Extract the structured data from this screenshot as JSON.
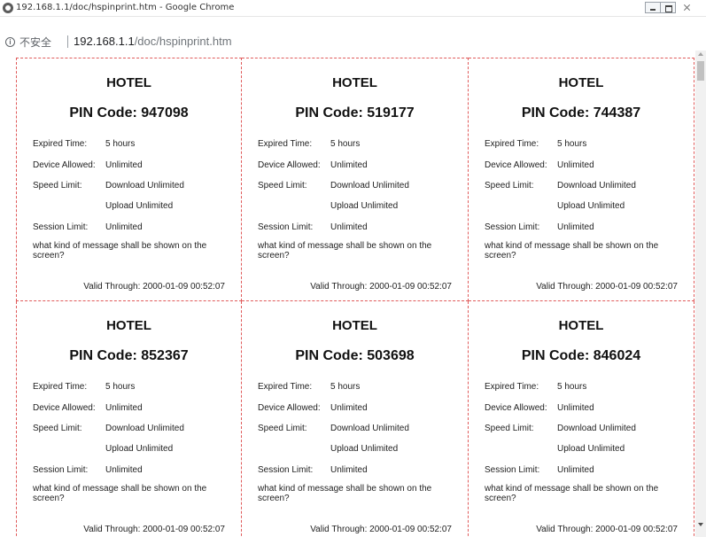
{
  "window": {
    "title": "192.168.1.1/doc/hspinprint.htm - Google Chrome"
  },
  "addressbar": {
    "security_label": "不安全",
    "url_host": "192.168.1.1",
    "url_path": "/doc/hspinprint.htm"
  },
  "labels": {
    "expired_time": "Expired Time:",
    "device_allowed": "Device Allowed:",
    "speed_limit": "Speed Limit:",
    "session_limit": "Session Limit:"
  },
  "cards": [
    {
      "hotel": "HOTEL",
      "pin": "PIN Code: 947098",
      "expired": "5 hours",
      "device": "Unlimited",
      "download": "Download Unlimited",
      "upload": "Upload Unlimited",
      "session": "Unlimited",
      "message": "what kind of message shall be shown on the screen?",
      "valid": "Valid Through: 2000-01-09 00:52:07"
    },
    {
      "hotel": "HOTEL",
      "pin": "PIN Code: 519177",
      "expired": "5 hours",
      "device": "Unlimited",
      "download": "Download Unlimited",
      "upload": "Upload Unlimited",
      "session": "Unlimited",
      "message": "what kind of message shall be shown on the screen?",
      "valid": "Valid Through: 2000-01-09 00:52:07"
    },
    {
      "hotel": "HOTEL",
      "pin": "PIN Code: 744387",
      "expired": "5 hours",
      "device": "Unlimited",
      "download": "Download Unlimited",
      "upload": "Upload Unlimited",
      "session": "Unlimited",
      "message": "what kind of message shall be shown on the screen?",
      "valid": "Valid Through: 2000-01-09 00:52:07"
    },
    {
      "hotel": "HOTEL",
      "pin": "PIN Code: 852367",
      "expired": "5 hours",
      "device": "Unlimited",
      "download": "Download Unlimited",
      "upload": "Upload Unlimited",
      "session": "Unlimited",
      "message": "what kind of message shall be shown on the screen?",
      "valid": "Valid Through: 2000-01-09 00:52:07"
    },
    {
      "hotel": "HOTEL",
      "pin": "PIN Code: 503698",
      "expired": "5 hours",
      "device": "Unlimited",
      "download": "Download Unlimited",
      "upload": "Upload Unlimited",
      "session": "Unlimited",
      "message": "what kind of message shall be shown on the screen?",
      "valid": "Valid Through: 2000-01-09 00:52:07"
    },
    {
      "hotel": "HOTEL",
      "pin": "PIN Code: 846024",
      "expired": "5 hours",
      "device": "Unlimited",
      "download": "Download Unlimited",
      "upload": "Upload Unlimited",
      "session": "Unlimited",
      "message": "what kind of message shall be shown on the screen?",
      "valid": "Valid Through: 2000-01-09 00:52:07"
    }
  ],
  "colors": {
    "card_border": "#e05a5a"
  }
}
